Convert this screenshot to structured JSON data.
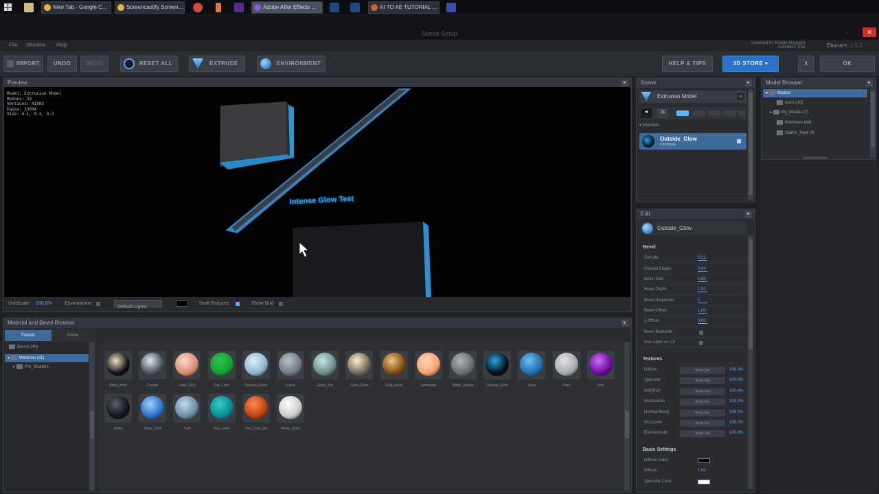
{
  "taskbar": {
    "tabs": [
      {
        "label": "New Tab - Google C...",
        "color": "#e8b43a"
      },
      {
        "label": "Screencastify Screen...",
        "color": "#e8b43a"
      },
      {
        "label": "Adobe After Effects ...",
        "color": "#8a5cd8"
      },
      {
        "label": "AI TO AE TUTORIAL ...",
        "color": "#d06030"
      }
    ]
  },
  "window": {
    "title": "Scene Setup"
  },
  "menu": {
    "items": [
      "File",
      "Window",
      "Help"
    ],
    "user_line1": "Licensed to: Simple Mograph",
    "user_line2": "Activated: Trial",
    "element": "Element",
    "version": "1.5.2"
  },
  "toolbar": {
    "import": "IMPORT",
    "undo": "UNDO",
    "redo": "REDO",
    "reset_all": "RESET ALL",
    "extrude": "EXTRUDE",
    "environment": "ENVIRONMENT",
    "help_tips": "HELP & TIPS",
    "store": "3D STORE",
    "close_x": "X",
    "ok": "OK"
  },
  "preview": {
    "title": "Preview",
    "stats": [
      "Model: Extrusion Model",
      "Meshes: 33",
      "Vertices: 41082",
      "Faces: 13094",
      "Size: 0.1, 0.4, 0.2"
    ],
    "floating_text": "Intense Glow Test",
    "bottom": {
      "unit_label": "UnitScale",
      "unit_value": "100.0%",
      "environment": "Environment",
      "lights": "Default Lights",
      "draft": "Draft Textures",
      "show_grid": "Show Grid"
    }
  },
  "scene": {
    "title": "Scene",
    "model_name": "Extrusion Model",
    "materials_label": "Materials",
    "material": {
      "name": "Outside_Glow",
      "sub": "0 Textures"
    }
  },
  "edit": {
    "title": "Edit",
    "material_name": "Outside_Glow",
    "bevel_title": "Bevel",
    "bevel_rows": [
      {
        "label": "Extrude",
        "value": "0.22"
      },
      {
        "label": "Expand Edges",
        "value": "0.00"
      },
      {
        "label": "Bevel Size",
        "value": "0.50"
      },
      {
        "label": "Bevel Depth",
        "value": "1.00"
      },
      {
        "label": "Bevel Segments",
        "value": "2"
      },
      {
        "label": "Bevel Offset",
        "value": "1.00"
      },
      {
        "label": "Z Offset",
        "value": "0.00"
      },
      {
        "label": "Bevel Backside",
        "value": ""
      },
      {
        "label": "Use Layer as UV",
        "value": ""
      }
    ],
    "textures_title": "Textures",
    "texture_rows": [
      {
        "label": "Diffuse",
        "btn": "None Set",
        "value": "100.0%"
      },
      {
        "label": "Specular",
        "btn": "None Set",
        "value": "100.0%"
      },
      {
        "label": "Refl/Refr",
        "btn": "None Set",
        "value": "100.0%"
      },
      {
        "label": "Illumination",
        "btn": "None Set",
        "value": "100.0%"
      },
      {
        "label": "Normal Bump",
        "btn": "None Set",
        "value": "100.0%"
      },
      {
        "label": "Occlusion",
        "btn": "None Set",
        "value": "100.0%"
      },
      {
        "label": "Environment",
        "btn": "None Set",
        "value": "100.0%"
      }
    ],
    "basic_title": "Basic Settings",
    "basic_rows": [
      {
        "label": "Diffuse Color",
        "value": ""
      },
      {
        "label": "Diffuse",
        "value": "1.00"
      },
      {
        "label": "Specular Color",
        "value": ""
      }
    ]
  },
  "model_browser": {
    "title": "Model Browser",
    "root": "Models",
    "items": [
      "Icons (10)",
      "My_Models (7)",
      "Primitives (84)",
      "Starter_Pack (9)"
    ]
  },
  "material_browser": {
    "title": "Material and Bevel Browser",
    "tabs": [
      "Presets",
      "Scene"
    ],
    "tree": [
      "Bevels (40)",
      "Materials (31)",
      "Pro_Shaders"
    ],
    "materials": [
      {
        "name": "Black_Hole",
        "color": "#101014",
        "hl": "#f0e0c0"
      },
      {
        "name": "Chrome",
        "color": "#4a5058",
        "hl": "#dfe6ee"
      },
      {
        "name": "Fake_SSS",
        "color": "#d88c70",
        "hl": "#ffd8c8"
      },
      {
        "name": "Flat_Color",
        "color": "#12a032",
        "hl": "#30c050"
      },
      {
        "name": "Frosted_Glass",
        "color": "#8fb4cc",
        "hl": "#e0f0ff"
      },
      {
        "name": "Glass",
        "color": "#6f7a80",
        "hl": "#b8c4c8"
      },
      {
        "name": "Glass_Tint",
        "color": "#6e8a88",
        "hl": "#c8e8e4"
      },
      {
        "name": "Glow_Glass",
        "color": "#706858",
        "hl": "#fff0d0"
      },
      {
        "name": "Gold_Basic",
        "color": "#7a4a14",
        "hl": "#f0c880"
      },
      {
        "name": "Iluminated",
        "color": "#f4a070",
        "hl": "#ffd8b8"
      },
      {
        "name": "Matte_Shader",
        "color": "#6a6c70",
        "hl": "#b0b2b6"
      },
      {
        "name": "Outside_Glow",
        "color": "#041018",
        "hl": "#2aa0e0"
      },
      {
        "name": "Paint",
        "color": "#1c6eb0",
        "hl": "#6ec0f0"
      },
      {
        "name": "Plain",
        "color": "#a8aaae",
        "hl": "#e0e2e4"
      },
      {
        "name": "Purp",
        "color": "#6a0aa0",
        "hl": "#d070f0"
      },
      {
        "name": "Shiny",
        "color": "#101418",
        "hl": "#5a6068"
      },
      {
        "name": "Shiny_Light",
        "color": "#2a6cc0",
        "hl": "#a0d4ff"
      },
      {
        "name": "Soft",
        "color": "#6a8aa0",
        "hl": "#c0dcec"
      },
      {
        "name": "Two_Color",
        "color": "#0a8a90",
        "hl": "#30d0c0"
      },
      {
        "name": "Two_Color_Re",
        "color": "#c04010",
        "hl": "#ff8a50"
      },
      {
        "name": "White_Shiny",
        "color": "#c8c8c8",
        "hl": "#ffffff"
      }
    ]
  }
}
